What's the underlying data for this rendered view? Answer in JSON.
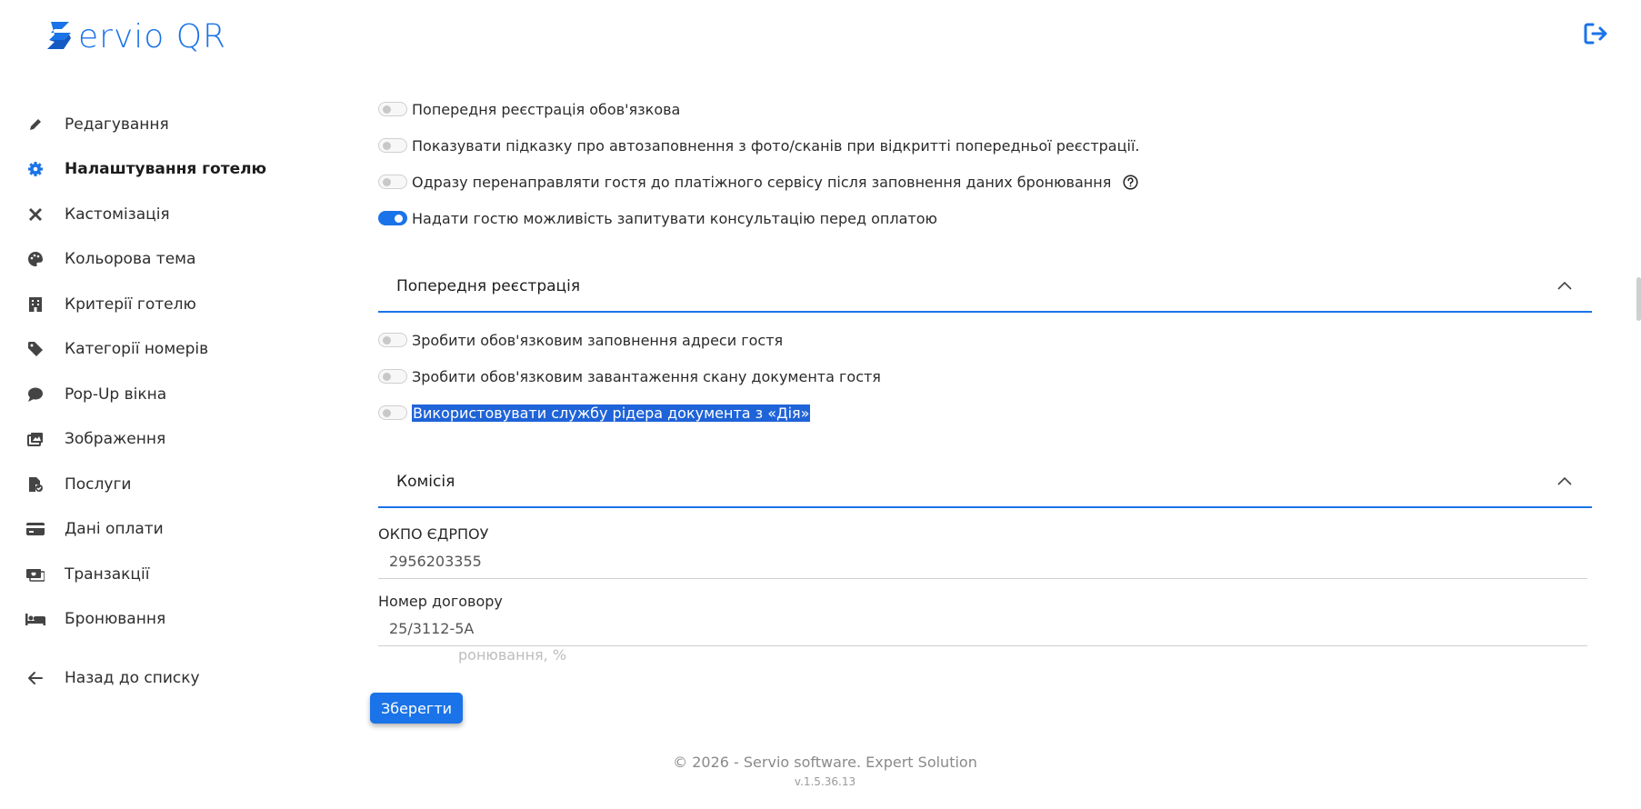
{
  "header": {
    "logo_text": "ervio QR",
    "logout_icon": "logout-icon",
    "brand_color": "#1a73e8"
  },
  "sidebar": {
    "items": [
      {
        "label": "Редагування",
        "icon": "pencil-icon",
        "active": false
      },
      {
        "label": "Налаштування готелю",
        "icon": "gear-icon",
        "active": true
      },
      {
        "label": "Кастомізація",
        "icon": "tools-icon",
        "active": false
      },
      {
        "label": "Кольорова тема",
        "icon": "palette-icon",
        "active": false
      },
      {
        "label": "Критерії готелю",
        "icon": "building-icon",
        "active": false
      },
      {
        "label": "Категорії номерів",
        "icon": "tag-icon",
        "active": false
      },
      {
        "label": "Pop-Up вікна",
        "icon": "chat-icon",
        "active": false
      },
      {
        "label": "Зображення",
        "icon": "images-icon",
        "active": false
      },
      {
        "label": "Послуги",
        "icon": "service-icon",
        "active": false
      },
      {
        "label": "Дані оплати",
        "icon": "credit-card-icon",
        "active": false
      },
      {
        "label": "Транзакції",
        "icon": "money-icon",
        "active": false
      },
      {
        "label": "Бронювання",
        "icon": "bed-icon",
        "active": false
      }
    ],
    "back_label": "Назад до списку",
    "back_icon": "arrow-left-icon"
  },
  "toggles_top": [
    {
      "label": "Попередня реєстрація обов'язкова",
      "on": false
    },
    {
      "label": "Показувати підказку про автозаповнення з фото/сканів при відкритті попередньої реєстрації.",
      "on": false
    },
    {
      "label": "Одразу перенаправляти гостя до платіжного сервісу після заповнення даних бронювання",
      "on": false,
      "help": true
    },
    {
      "label": "Надати гостю можливість запитувати консультацію перед оплатою",
      "on": true
    }
  ],
  "sections": {
    "pre_registration": {
      "title": "Попередня реєстрація",
      "toggles": [
        {
          "label": "Зробити обов'язковим заповнення адреси гостя",
          "on": false
        },
        {
          "label": "Зробити обов'язковим завантаження скану документа гостя",
          "on": false
        },
        {
          "label": "Використовувати службу рідера документа з «Дія»",
          "on": false,
          "selected": true
        }
      ]
    },
    "commission": {
      "title": "Комісія",
      "okpo_label": "ОКПО ЄДРПОУ",
      "okpo_value": "2956203355",
      "contract_label": "Номер договору",
      "contract_value": "25/3112-5А",
      "booking_label_partial": "ронювання, %"
    }
  },
  "save_label": "Зберегти",
  "footer": {
    "copyright": "© 2026 - Servio software. Expert Solution",
    "version": "v.1.5.36.13"
  }
}
